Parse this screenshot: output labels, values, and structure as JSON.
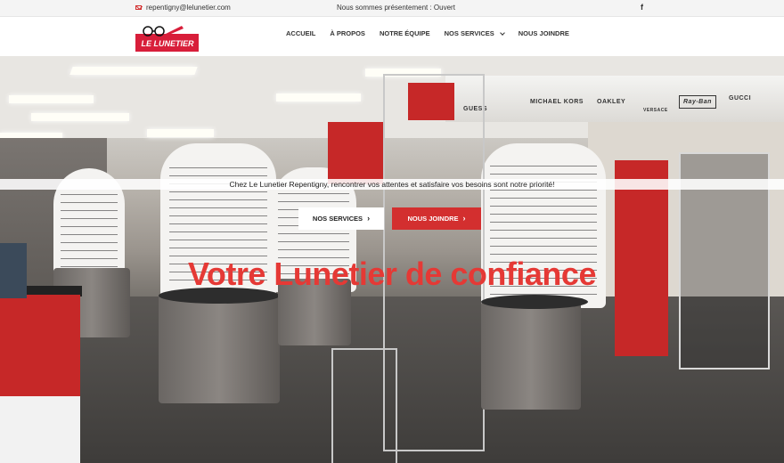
{
  "topbar": {
    "email": "repentigny@lelunetier.com",
    "status": "Nous sommes présentement : Ouvert",
    "social_icon": "f"
  },
  "header": {
    "logo_text": "LE LUNETIER",
    "nav": [
      {
        "label": "ACCUEIL"
      },
      {
        "label": "À PROPOS"
      },
      {
        "label": "NOTRE ÉQUIPE"
      },
      {
        "label": "NOS SERVICES"
      },
      {
        "label": "NOUS JOINDRE"
      }
    ]
  },
  "hero": {
    "tagline": "Chez Le Lunetier Repentigny, rencontrer vos attentes et satisfaire vos besoins sont notre priorité!",
    "button_services": "NOS SERVICES",
    "button_join": "NOUS JOINDRE",
    "button_arrow": "›",
    "headline": "Votre Lunetier de confiance",
    "brands": [
      "GUESS",
      "MICHAEL KORS",
      "OAKLEY",
      "VERSACE",
      "Ray-Ban",
      "GUCCI"
    ]
  },
  "colors": {
    "accent": "#d32f2f",
    "headline": "#e53935"
  }
}
